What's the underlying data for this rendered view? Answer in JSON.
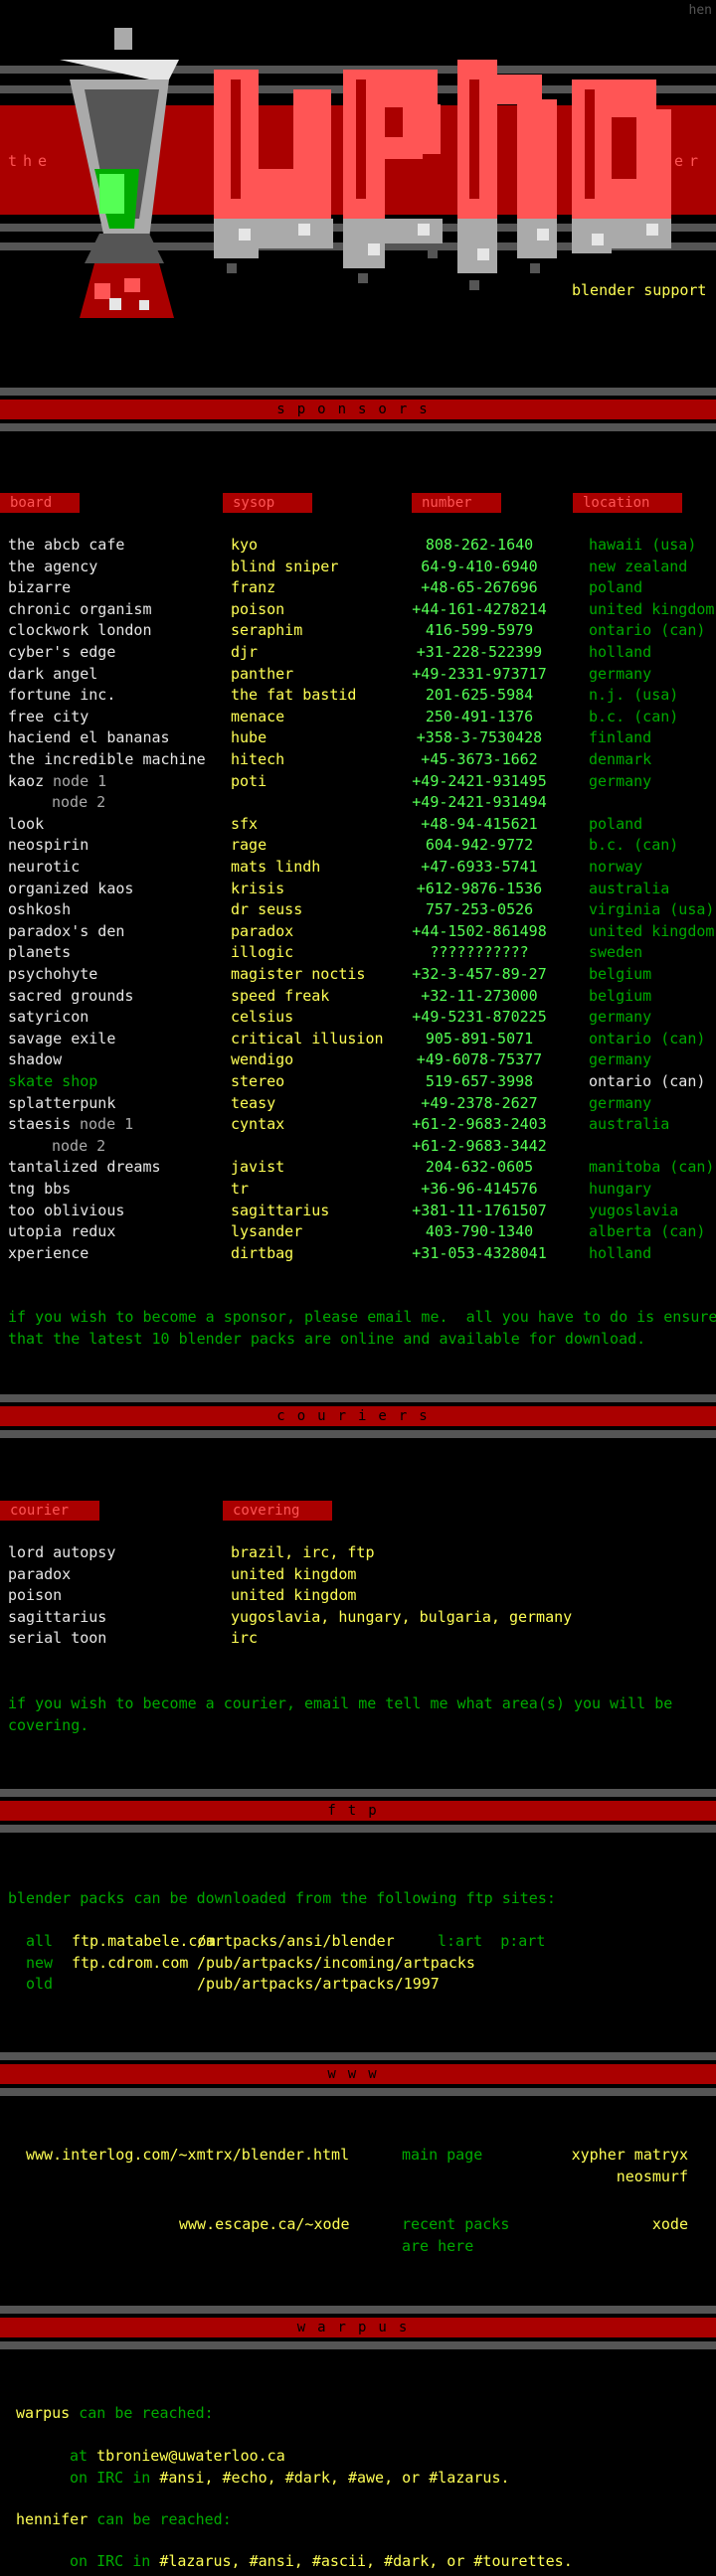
{
  "corner_tag": "hen",
  "logo": {
    "left_word": "the",
    "right_word": "er",
    "tagline": "blender support"
  },
  "colors": {
    "red": "#aa0000",
    "yellow": "#ffff55",
    "green": "#00aa00",
    "light_green": "#55ff55",
    "gray": "#555555"
  },
  "sections": {
    "sponsors": "sponsors",
    "couriers": "couriers",
    "ftp": "ftp",
    "www": "www",
    "warpus": "warpus"
  },
  "sponsors_table": {
    "headers": [
      "board",
      "sysop",
      "number",
      "location"
    ],
    "rows": [
      {
        "board": "the abcb cafe",
        "sysop": "kyo",
        "number": "808-262-1640",
        "location": "hawaii (usa)"
      },
      {
        "board": "the agency",
        "sysop": "blind sniper",
        "number": "64-9-410-6940",
        "location": "new zealand"
      },
      {
        "board": "bizarre",
        "sysop": "franz",
        "number": "+48-65-267696",
        "location": "poland"
      },
      {
        "board": "chronic organism",
        "sysop": "poison",
        "number": "+44-161-4278214",
        "location": "united kingdom"
      },
      {
        "board": "clockwork london",
        "sysop": "seraphim",
        "number": "416-599-5979",
        "location": "ontario (can)"
      },
      {
        "board": "cyber's edge",
        "sysop": "djr",
        "number": "+31-228-522399",
        "location": "holland"
      },
      {
        "board": "dark angel",
        "sysop": "panther",
        "number": "+49-2331-973717",
        "location": "germany"
      },
      {
        "board": "fortune inc.",
        "sysop": "the fat bastid",
        "number": "201-625-5984",
        "location": "n.j. (usa)"
      },
      {
        "board": "free city",
        "sysop": "menace",
        "number": "250-491-1376",
        "location": "b.c. (can)"
      },
      {
        "board": "haciend el bananas",
        "sysop": "hube",
        "number": "+358-3-7530428",
        "location": "finland"
      },
      {
        "board": "the incredible machine",
        "sysop": "hitech",
        "number": "+45-3673-1662",
        "location": "denmark"
      },
      {
        "board": "kaoz",
        "node": "node 1",
        "sysop": "poti",
        "number": "+49-2421-931495",
        "location": "germany"
      },
      {
        "board": "",
        "node": "node 2",
        "sysop": "",
        "number": "+49-2421-931494",
        "location": ""
      },
      {
        "board": "look",
        "sysop": "sfx",
        "number": "+48-94-415621",
        "location": "poland"
      },
      {
        "board": "neospirin",
        "sysop": "rage",
        "number": "604-942-9772",
        "location": "b.c. (can)"
      },
      {
        "board": "neurotic",
        "sysop": "mats lindh",
        "number": "+47-6933-5741",
        "location": "norway"
      },
      {
        "board": "organized kaos",
        "sysop": "krisis",
        "number": "+612-9876-1536",
        "location": "australia"
      },
      {
        "board": "oshkosh",
        "sysop": "dr seuss",
        "number": "757-253-0526",
        "location": "virginia (usa)"
      },
      {
        "board": "paradox's den",
        "sysop": "paradox",
        "number": "+44-1502-861498",
        "location": "united kingdom"
      },
      {
        "board": "planets",
        "sysop": "illogic",
        "number": "???????????",
        "location": "sweden"
      },
      {
        "board": "psychohyte",
        "sysop": "magister noctis",
        "number": "+32-3-457-89-27",
        "location": "belgium"
      },
      {
        "board": "sacred grounds",
        "sysop": "speed freak",
        "number": "+32-11-273000",
        "location": "belgium"
      },
      {
        "board": "satyricon",
        "sysop": "celsius",
        "number": "+49-5231-870225",
        "location": "germany"
      },
      {
        "board": "savage exile",
        "sysop": "critical illusion",
        "number": "905-891-5071",
        "location": "ontario (can)"
      },
      {
        "board": "shadow",
        "sysop": "wendigo",
        "number": "+49-6078-75377",
        "location": "germany"
      },
      {
        "board": "skate shop",
        "sysop": "stereo",
        "number": "519-657-3998",
        "location": "ontario (can)",
        "highlight": true
      },
      {
        "board": "splatterpunk",
        "sysop": "teasy",
        "number": "+49-2378-2627",
        "location": "germany"
      },
      {
        "board": "staesis",
        "node": "node 1",
        "sysop": "cyntax",
        "number": "+61-2-9683-2403",
        "location": "australia"
      },
      {
        "board": "",
        "node": "node 2",
        "sysop": "",
        "number": "+61-2-9683-3442",
        "location": ""
      },
      {
        "board": "tantalized dreams",
        "sysop": "javist",
        "number": "204-632-0605",
        "location": "manitoba (can)"
      },
      {
        "board": "tng bbs",
        "sysop": "tr",
        "number": "+36-96-414576",
        "location": "hungary"
      },
      {
        "board": "too oblivious",
        "sysop": "sagittarius",
        "number": "+381-11-1761507",
        "location": "yugoslavia"
      },
      {
        "board": "utopia redux",
        "sysop": "lysander",
        "number": "403-790-1340",
        "location": "alberta (can)"
      },
      {
        "board": "xperience",
        "sysop": "dirtbag",
        "number": "+31-053-4328041",
        "location": "holland"
      }
    ]
  },
  "sponsor_note": [
    "if you wish to become a sponsor, please email me.  all you have to do is ensure",
    "that the latest 10 blender packs are online and available for download."
  ],
  "couriers_table": {
    "headers": [
      "courier",
      "covering"
    ],
    "rows": [
      {
        "courier": "lord autopsy",
        "covering": "brazil, irc, ftp"
      },
      {
        "courier": "paradox",
        "covering": "united kingdom"
      },
      {
        "courier": "poison",
        "covering": "united kingdom"
      },
      {
        "courier": "sagittarius",
        "covering": "yugoslavia, hungary, bulgaria, germany"
      },
      {
        "courier": "serial toon",
        "covering": "irc"
      }
    ]
  },
  "courier_note": [
    "if you wish to become a courier, email me tell me what area(s) you will be",
    "covering."
  ],
  "ftp": {
    "intro": "blender packs can be downloaded from the following ftp sites:",
    "rows": [
      {
        "tag": "all",
        "host": "ftp.matabele.com",
        "path": "/artpacks/ansi/blender",
        "extra": "l:art  p:art"
      },
      {
        "tag": "new",
        "host": "ftp.cdrom.com",
        "path": "/pub/artpacks/incoming/artpacks",
        "extra": ""
      },
      {
        "tag": "old",
        "host": "",
        "path": "/pub/artpacks/artpacks/1997",
        "extra": ""
      }
    ]
  },
  "www": {
    "rows": [
      {
        "url": "www.interlog.com/~xmtrx/blender.html",
        "desc": [
          "main page"
        ],
        "who": [
          "xypher matryx",
          "neosmurf"
        ]
      },
      {
        "url": "www.escape.ca/~xode",
        "desc": [
          "recent packs",
          "are here"
        ],
        "who": [
          "xode"
        ]
      }
    ]
  },
  "warpus": {
    "name1": "warpus",
    "reach1": "can be reached:",
    "line1_pre": "at",
    "line1_val": "tbroniew@uwaterloo.ca",
    "line2_pre": "on IRC in",
    "line2_chans": "#ansi, #echo, #dark, #awe, or #lazarus.",
    "name2": "hennifer",
    "reach2": "can be reached:",
    "line3_pre": "on IRC in",
    "line3_chans": "#lazarus, #ansi, #ascii, #dark, or #tourettes."
  }
}
